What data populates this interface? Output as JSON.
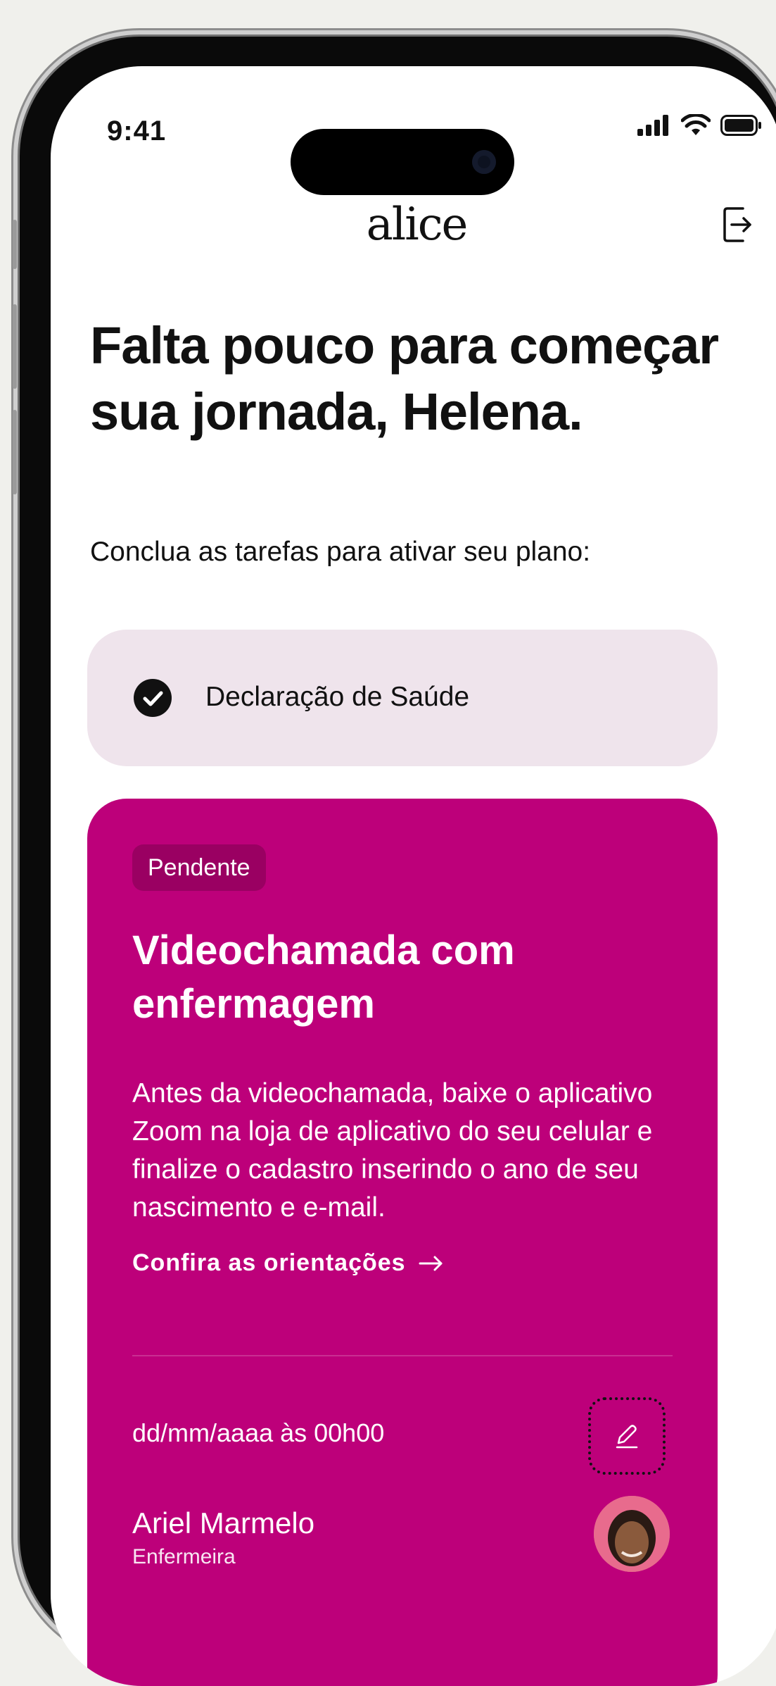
{
  "status_bar": {
    "time": "9:41"
  },
  "header": {
    "logo": "alice"
  },
  "headline": "Falta pouco para começar sua jornada, Helena.",
  "subhead": "Conclua as tarefas para ativar seu plano:",
  "completed_task": {
    "label": "Declaração de Saúde"
  },
  "pending_task": {
    "badge": "Pendente",
    "title": "Videochamada com enfermagem",
    "description": "Antes da videochamada, baixe o aplicativo Zoom na loja de aplicativo do seu celular e finalize o cadastro inserindo o ano de seu nascimento e e-mail.",
    "link_label": "Confira as orientações",
    "schedule": "dd/mm/aaaa  às 00h00",
    "nurse_name": "Ariel Marmelo",
    "nurse_role": "Enfermeira"
  },
  "colors": {
    "accent": "#bd007a",
    "badge_bg": "#9a0062",
    "done_card_bg": "#efe4ec"
  }
}
